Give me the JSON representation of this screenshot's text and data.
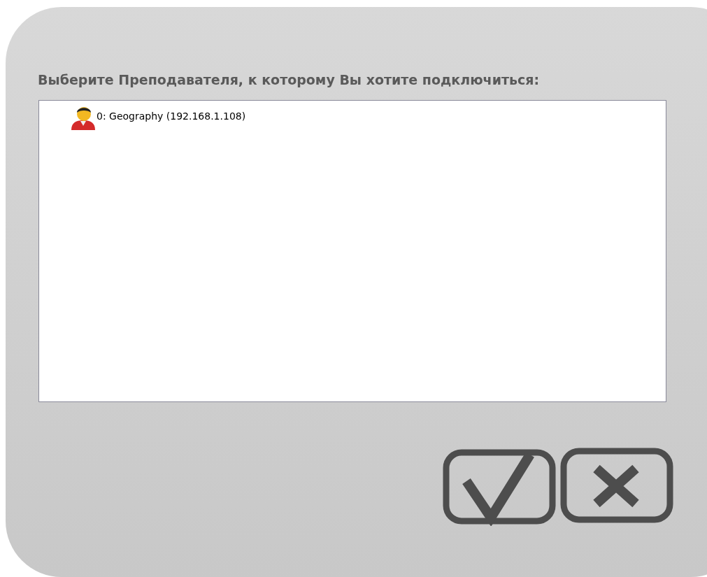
{
  "prompt": "Выберите Преподавателя, к которому Вы хотите подключиться:",
  "teachers": [
    {
      "label": "0: Geography (192.168.1.108)"
    }
  ],
  "buttons": [
    {
      "kind": "confirm"
    },
    {
      "kind": "cancel"
    }
  ]
}
